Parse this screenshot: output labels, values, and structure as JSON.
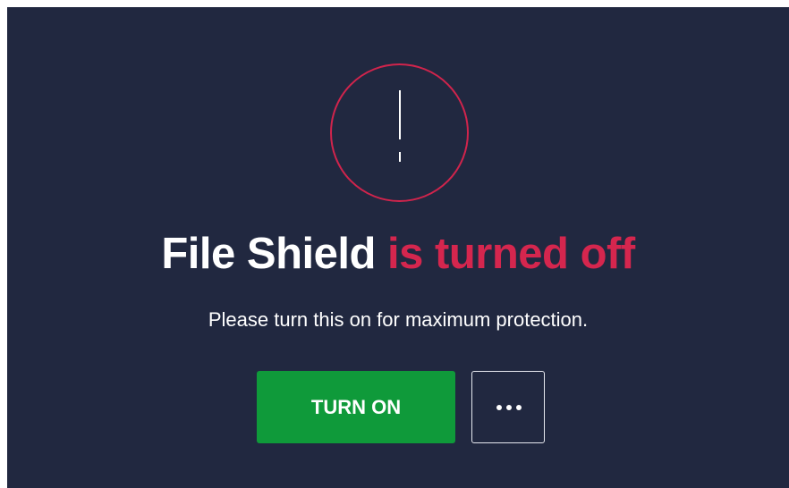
{
  "status": {
    "feature_name": "File Shield",
    "state_text": "is turned off",
    "message": "Please turn this on for maximum protection."
  },
  "actions": {
    "turn_on_label": "TURN ON",
    "more_icon": "more-horizontal-icon"
  },
  "icons": {
    "alert": "exclamation-circle-icon"
  },
  "colors": {
    "background": "#212840",
    "alert_accent": "#d5264e",
    "primary_button": "#0f9a3a",
    "text": "#ffffff"
  }
}
